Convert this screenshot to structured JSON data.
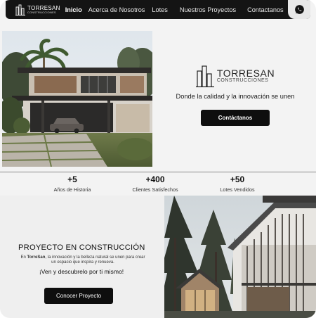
{
  "nav": {
    "logo_name": "TORRESAN",
    "logo_sub": "CONSTRUCCIONES",
    "links": [
      {
        "label": "Inicio",
        "active": true
      },
      {
        "label": "Acerca de Nosotros",
        "active": false
      },
      {
        "label": "Lotes",
        "active": false
      },
      {
        "label": "Nuestros Proyectos",
        "active": false
      },
      {
        "label": "Contactanos",
        "active": false
      }
    ],
    "whatsapp_icon": "whatsapp-icon"
  },
  "hero": {
    "brand_name": "TORRESAN",
    "brand_sub": "CONSTRUCCIONES",
    "tagline": "Donde la calidad y la innovación se unen",
    "cta_label": "Contáctanos"
  },
  "stats": [
    {
      "value": "+5",
      "label": "Años de Historia"
    },
    {
      "value": "+400",
      "label": "Clientes Satisfechos"
    },
    {
      "value": "+50",
      "label": "Lotes Vendidos"
    }
  ],
  "project": {
    "title": "PROYECTO EN CONSTRUCCIÓN",
    "desc_prefix": "En ",
    "desc_brand": "TorreSan",
    "desc_rest": ", la innovación y la belleza natural se unen para crear un espacio que inspira y renueva.",
    "cta_text": "¡Ven y descubrelo por ti mismo!",
    "button_label": "Conocer Proyecto"
  },
  "colors": {
    "nav_bg": "#141414",
    "button_bg": "#0e0e0e",
    "page_bg": "#f3f3f3"
  }
}
